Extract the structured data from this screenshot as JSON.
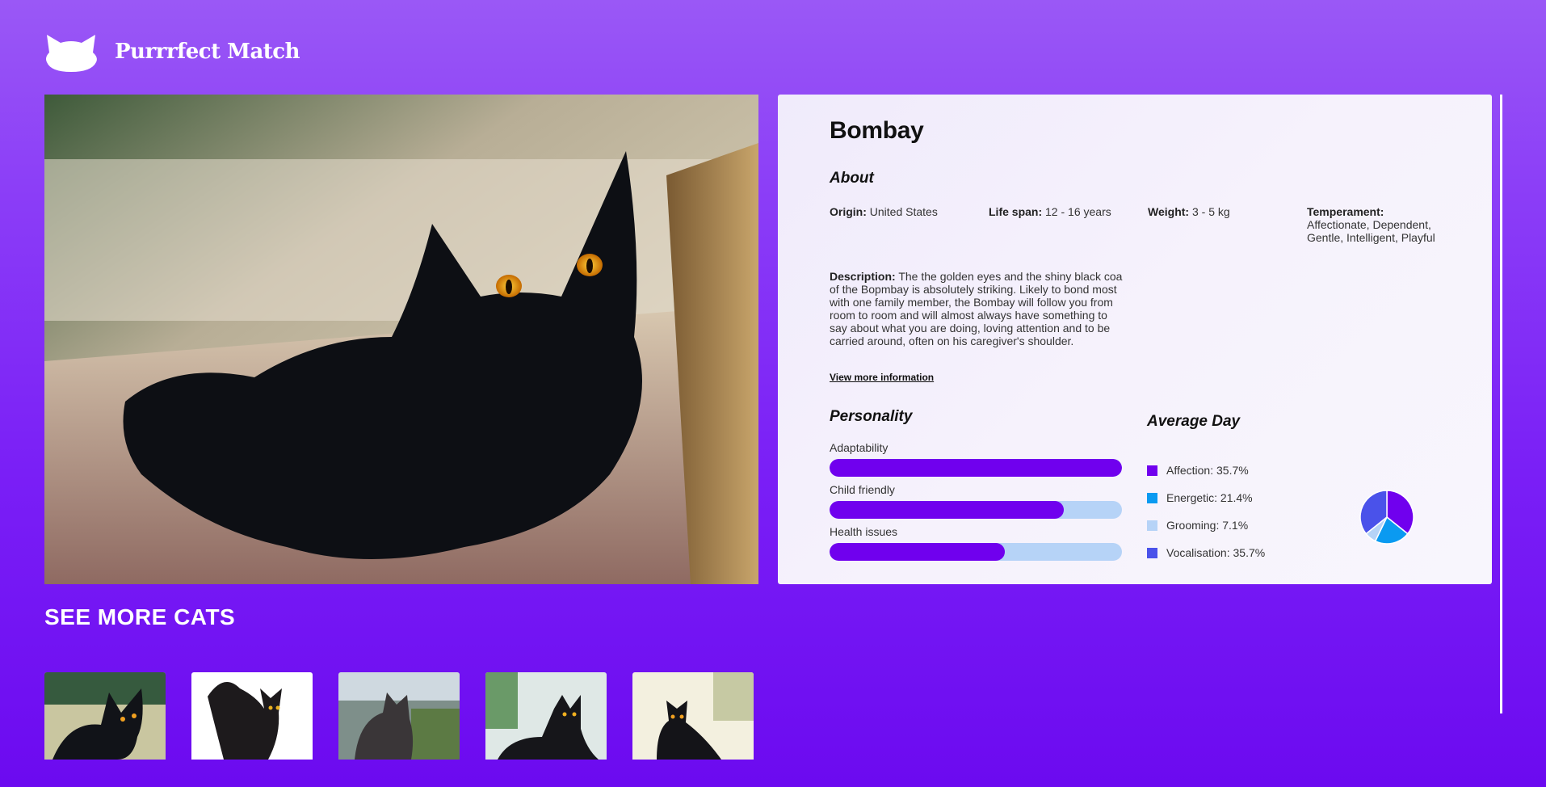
{
  "brand": {
    "name": "Purrrfect Match",
    "logo_icon": "cat-head-icon"
  },
  "hero": {
    "alt": "Bombay cat photo"
  },
  "breed": {
    "name": "Bombay",
    "about_title": "About",
    "origin_label": "Origin:",
    "origin": "United States",
    "lifespan_label": "Life span:",
    "lifespan": "12 - 16 years",
    "weight_label": "Weight:",
    "weight": "3 - 5 kg",
    "temperament_label": "Temperament:",
    "temperament": "Affectionate, Dependent, Gentle, Intelligent, Playful",
    "description_label": "Description:",
    "description": "The the golden eyes and the shiny black coa of the Bopmbay is absolutely striking. Likely to bond most with one family member, the Bombay will follow you from room to room and will almost always have something to say about what you are doing, loving attention and to be carried around, often on his caregiver's shoulder.",
    "more_link": "View more information"
  },
  "personality": {
    "title": "Personality",
    "traits": [
      {
        "label": "Adaptability",
        "value": 1.0
      },
      {
        "label": "Child friendly",
        "value": 0.8
      },
      {
        "label": "Health issues",
        "value": 0.6
      }
    ]
  },
  "average_day": {
    "title": "Average Day",
    "items": [
      {
        "label": "Affection: 35.7%",
        "color": "#7000ee"
      },
      {
        "label": "Energetic: 21.4%",
        "color": "#0a9af1"
      },
      {
        "label": "Grooming: 7.1%",
        "color": "#b6d3f7"
      },
      {
        "label": "Vocalisation: 35.7%",
        "color": "#4a52ea"
      }
    ]
  },
  "chart_data": {
    "type": "pie",
    "categories": [
      "Affection",
      "Energetic",
      "Grooming",
      "Vocalisation"
    ],
    "values": [
      35.7,
      21.4,
      7.1,
      35.7
    ],
    "colors": [
      "#7000ee",
      "#0a9af1",
      "#b6d3f7",
      "#4a52ea"
    ],
    "title": ""
  },
  "see_more": {
    "title": "SEE MORE CATS",
    "thumbnails": [
      "cat-thumbnail-1",
      "cat-thumbnail-2",
      "cat-thumbnail-3",
      "cat-thumbnail-4",
      "cat-thumbnail-5"
    ]
  }
}
